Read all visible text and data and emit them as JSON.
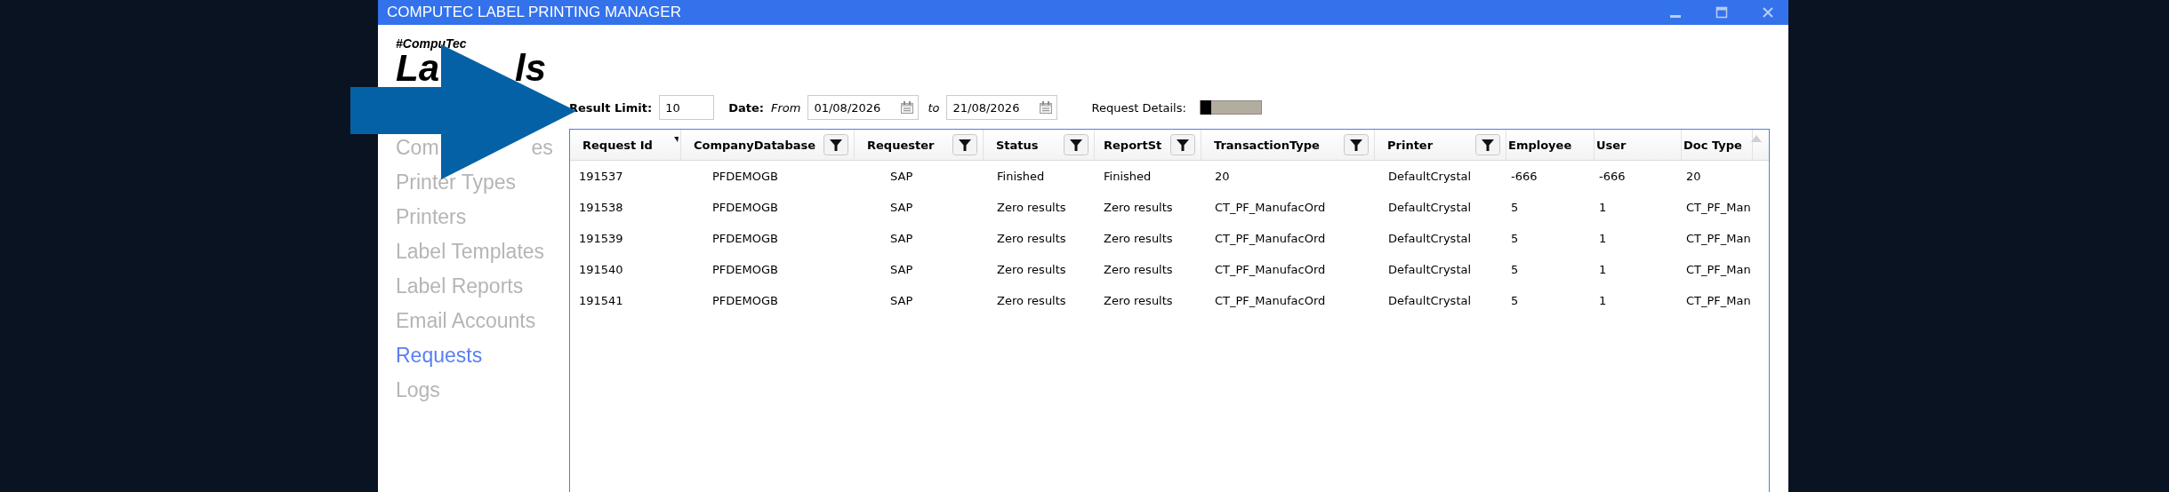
{
  "window": {
    "title": "COMPUTEC LABEL PRINTING MANAGER"
  },
  "logo": {
    "tag": "#CompuTec",
    "title": "La",
    "title_end": "ls"
  },
  "sidebar": {
    "items": [
      {
        "label": "Com",
        "label_end": "es",
        "selected": false
      },
      {
        "label": "Printer Types",
        "selected": false
      },
      {
        "label": "Printers",
        "selected": false
      },
      {
        "label": "Label Templates",
        "selected": false
      },
      {
        "label": "Label Reports",
        "selected": false
      },
      {
        "label": "Email Accounts",
        "selected": false
      },
      {
        "label": "Requests",
        "selected": true
      },
      {
        "label": "Logs",
        "selected": false
      }
    ]
  },
  "filters": {
    "result_limit_label": "Result Limit:",
    "result_limit": "10",
    "date_label": "Date:",
    "from_label": "From",
    "from": "01/08/2026",
    "to_label": "to",
    "to": "21/08/2026",
    "details_label": "Request Details:",
    "details_on": false
  },
  "table": {
    "columns": [
      {
        "label": "Request Id",
        "filter": false
      },
      {
        "label": "CompanyDatabase",
        "filter": true
      },
      {
        "label": "Requester",
        "filter": true
      },
      {
        "label": "Status",
        "filter": true
      },
      {
        "label": "ReportSt",
        "filter": true
      },
      {
        "label": "TransactionType",
        "filter": true
      },
      {
        "label": "Printer",
        "filter": true
      },
      {
        "label": "Employee",
        "filter": false
      },
      {
        "label": "User",
        "filter": false
      },
      {
        "label": "Doc Type",
        "filter": false
      }
    ],
    "rows": [
      [
        "191537",
        "PFDEMOGB",
        "SAP",
        "Finished",
        "Finished",
        "20",
        "DefaultCrystal",
        "-666",
        "-666",
        "20"
      ],
      [
        "191538",
        "PFDEMOGB",
        "SAP",
        "Zero results",
        "Zero results",
        "CT_PF_ManufacOrd",
        "DefaultCrystal",
        "5",
        "1",
        "CT_PF_Man"
      ],
      [
        "191539",
        "PFDEMOGB",
        "SAP",
        "Zero results",
        "Zero results",
        "CT_PF_ManufacOrd",
        "DefaultCrystal",
        "5",
        "1",
        "CT_PF_Man"
      ],
      [
        "191540",
        "PFDEMOGB",
        "SAP",
        "Zero results",
        "Zero results",
        "CT_PF_ManufacOrd",
        "DefaultCrystal",
        "5",
        "1",
        "CT_PF_Man"
      ],
      [
        "191541",
        "PFDEMOGB",
        "SAP",
        "Zero results",
        "Zero results",
        "CT_PF_ManufacOrd",
        "DefaultCrystal",
        "5",
        "1",
        "CT_PF_Man"
      ]
    ]
  }
}
